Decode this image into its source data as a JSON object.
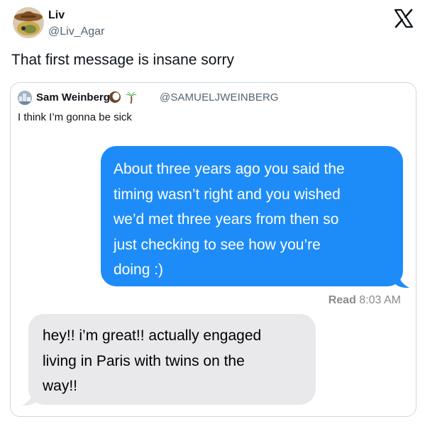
{
  "post": {
    "author_name": "Liv",
    "author_handle": "@Liv_Agar",
    "text": "That first message is insane sorry"
  },
  "quoted_post": {
    "author_name": "Sam Weinberg",
    "author_handle": "@SAMUELJWEINBERG",
    "text": "I think I’m gonna be sick"
  },
  "conversation": {
    "sent_message": {
      "lines": [
        "About three years ago you said the",
        "timing wasn’t right and you wished",
        "we’d met three years from then so",
        "just checking to see how you’re",
        "doing :)"
      ]
    },
    "read_receipt": {
      "label": "Read",
      "time": "8:03 AM"
    },
    "received_message": {
      "lines": [
        "hey!! i’m great!! actually engaged",
        "living in Paris with twins on the",
        "way!!"
      ]
    }
  },
  "colors": {
    "sent_bubble": "#1e8cf8",
    "received_bubble": "#e9e9eb",
    "card_border": "#cfd9de",
    "secondary_text": "#536471",
    "receipt_text": "#8a8a8e"
  },
  "icons": {
    "platform_logo": "x-logo-icon",
    "quoted_author_emojis": [
      "coconut-icon",
      "palm-tree-icon"
    ]
  }
}
